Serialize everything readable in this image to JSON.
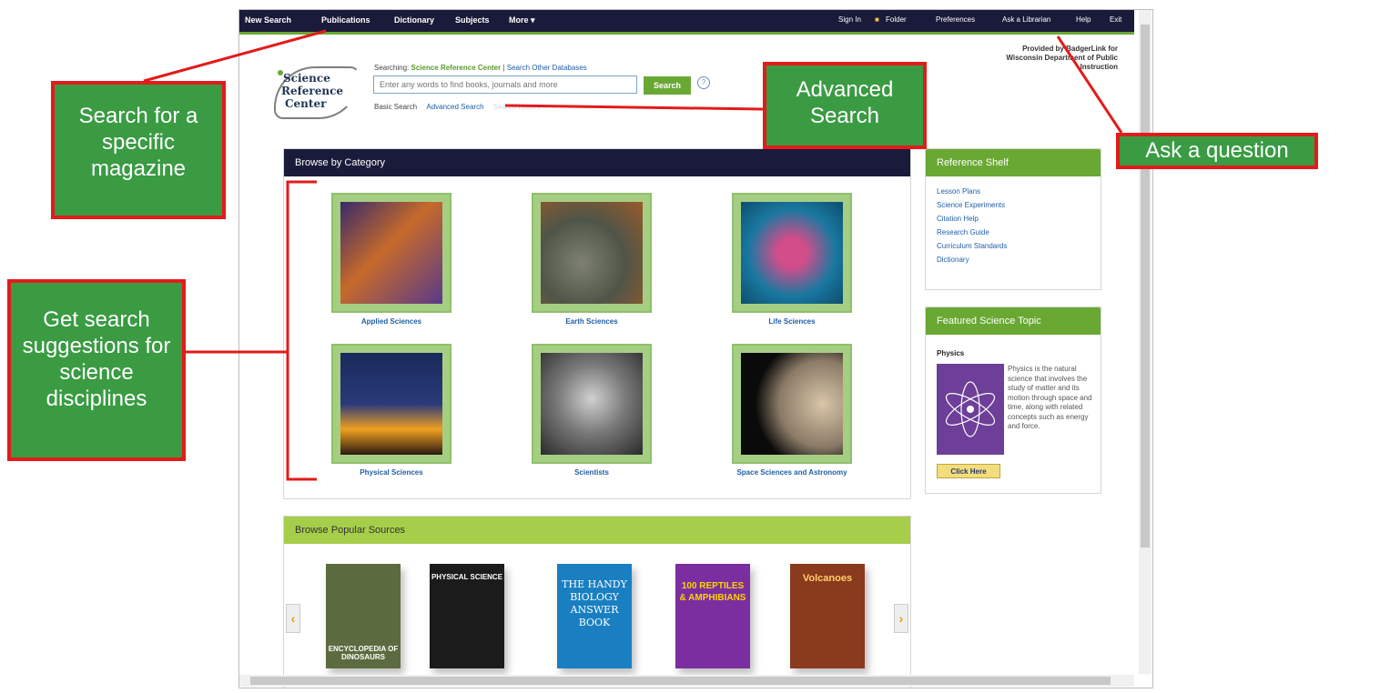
{
  "topnav": {
    "left": [
      "New Search",
      "Publications",
      "Dictionary",
      "Subjects",
      "More ▾"
    ],
    "right": [
      "Sign In",
      "Folder",
      "Preferences",
      "Ask a Librarian",
      "Help",
      "Exit"
    ]
  },
  "provided_by": "Provided by BadgerLink for Wisconsin Department of Public Instruction",
  "logo": {
    "line1": "Science",
    "line2": "Reference",
    "line3": "Center"
  },
  "searching": {
    "prefix": "Searching:",
    "database": "Science Reference Center",
    "other": "Search Other Databases"
  },
  "search": {
    "placeholder": "Enter any words to find books, journals and more",
    "button": "Search",
    "help": "?"
  },
  "search_links": {
    "basic": "Basic Search",
    "advanced": "Advanced Search",
    "history": "Search History"
  },
  "browse_category": {
    "title": "Browse by Category",
    "items": [
      {
        "label": "Applied Sciences"
      },
      {
        "label": "Earth Sciences"
      },
      {
        "label": "Life Sciences"
      },
      {
        "label": "Physical Sciences"
      },
      {
        "label": "Scientists"
      },
      {
        "label": "Space Sciences and Astronomy"
      }
    ]
  },
  "reference_shelf": {
    "title": "Reference Shelf",
    "links": [
      "Lesson Plans",
      "Science Experiments",
      "Citation Help",
      "Research Guide",
      "Curriculum Standards",
      "Dictionary"
    ]
  },
  "featured": {
    "title": "Featured Science Topic",
    "topic": "Physics",
    "description": "Physics is the natural science that involves the study of matter and its motion through space and time, along with related concepts such as energy and force.",
    "button": "Click Here"
  },
  "popular_sources": {
    "title": "Browse Popular Sources",
    "prev": "‹",
    "next": "›",
    "books": [
      {
        "title": "ENCYCLOPEDIA OF DINOSAURS",
        "color": "#5c6b3f"
      },
      {
        "title": "PHYSICAL SCIENCE",
        "color": "#1b1b1b"
      },
      {
        "title": "THE HANDY BIOLOGY ANSWER BOOK",
        "color": "#1a7fc1"
      },
      {
        "title": "100 REPTILES & AMPHIBIANS",
        "color": "#7b2ea0"
      },
      {
        "title": "Volcanoes",
        "color": "#8a3a1d"
      }
    ]
  },
  "callouts": {
    "magazine": "Search for a specific magazine",
    "advanced": "Advanced Search",
    "ask": "Ask a question",
    "disciplines": "Get search suggestions for science disciplines"
  },
  "colors": {
    "nav": "#1a1a3a",
    "accent_green": "#6aa834",
    "callout_fill": "#3a9b43",
    "callout_border": "#e21b1b",
    "link": "#1f5fa7"
  }
}
